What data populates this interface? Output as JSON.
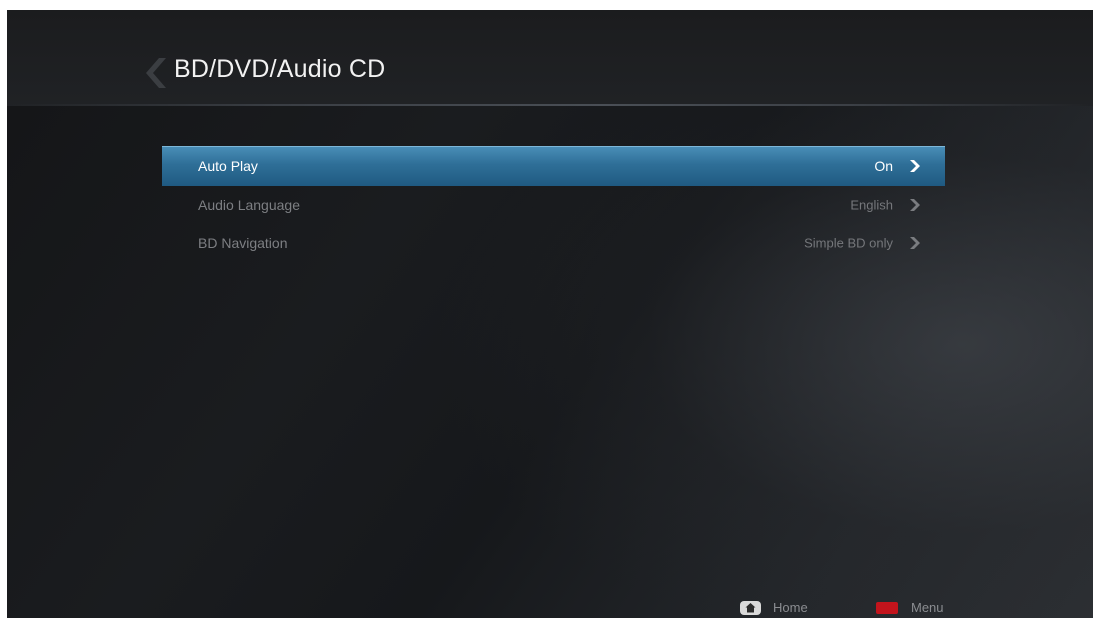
{
  "header": {
    "title": "BD/DVD/Audio CD",
    "back_icon": "chevron-left-icon"
  },
  "settings": [
    {
      "label": "Auto Play",
      "value": "On",
      "selected": true
    },
    {
      "label": "Audio Language",
      "value": "English",
      "selected": false
    },
    {
      "label": "BD Navigation",
      "value": "Simple BD only",
      "selected": false
    }
  ],
  "footer": {
    "home_icon": "home-key-icon",
    "home_label": "Home",
    "menu_icon": "red-key-icon",
    "menu_label": "Menu"
  },
  "colors": {
    "selection": "#2f6f98",
    "red_key": "#c3141c"
  }
}
